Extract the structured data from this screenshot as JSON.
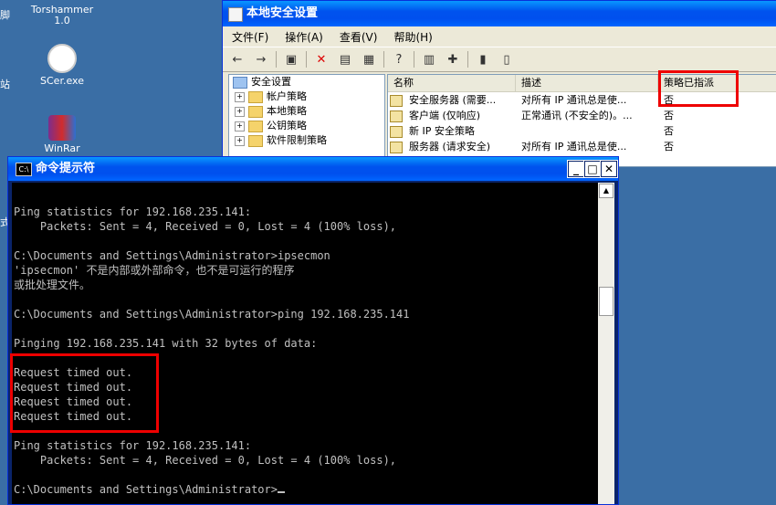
{
  "desktop": {
    "partial_left_label": "脚",
    "partial_left_label2": "站",
    "partial_left_label3": "式",
    "icons": [
      {
        "label": "Torshammer\n1.0"
      },
      {
        "label": "SCer.exe"
      },
      {
        "label": "WinRar"
      }
    ]
  },
  "mmc": {
    "title": "本地安全设置",
    "menu": [
      "文件(F)",
      "操作(A)",
      "查看(V)",
      "帮助(H)"
    ],
    "tree": [
      {
        "label": "安全设置",
        "level": 0,
        "expander": ""
      },
      {
        "label": "帐户策略",
        "level": 1,
        "expander": "+"
      },
      {
        "label": "本地策略",
        "level": 1,
        "expander": "+"
      },
      {
        "label": "公钥策略",
        "level": 1,
        "expander": "+"
      },
      {
        "label": "软件限制策略",
        "level": 1,
        "expander": "+"
      }
    ],
    "columns": [
      "名称",
      "描述",
      "策略已指派"
    ],
    "rows": [
      {
        "name": "安全服务器 (需要...",
        "desc": "对所有 IP 通讯总是使...",
        "assigned": "否"
      },
      {
        "name": "客户端 (仅响应)",
        "desc": "正常通讯 (不安全的)。...",
        "assigned": "否"
      },
      {
        "name": "新 IP 安全策略",
        "desc": "",
        "assigned": "否"
      },
      {
        "name": "服务器 (请求安全)",
        "desc": "对所有 IP 通讯总是使...",
        "assigned": "否"
      }
    ]
  },
  "cmd": {
    "title": "命令提示符",
    "console_text": "\nPing statistics for 192.168.235.141:\n    Packets: Sent = 4, Received = 0, Lost = 4 (100% loss),\n\nC:\\Documents and Settings\\Administrator>ipsecmon\n'ipsecmon' 不是内部或外部命令，也不是可运行的程序\n或批处理文件。\n\nC:\\Documents and Settings\\Administrator>ping 192.168.235.141\n\nPinging 192.168.235.141 with 32 bytes of data:\n\nRequest timed out.\nRequest timed out.\nRequest timed out.\nRequest timed out.\n\nPing statistics for 192.168.235.141:\n    Packets: Sent = 4, Received = 0, Lost = 4 (100% loss),\n\nC:\\Documents and Settings\\Administrator>"
  },
  "colors": {
    "highlight": "#e00000",
    "console_bg": "#000000",
    "console_fg": "#c0c0c0"
  }
}
